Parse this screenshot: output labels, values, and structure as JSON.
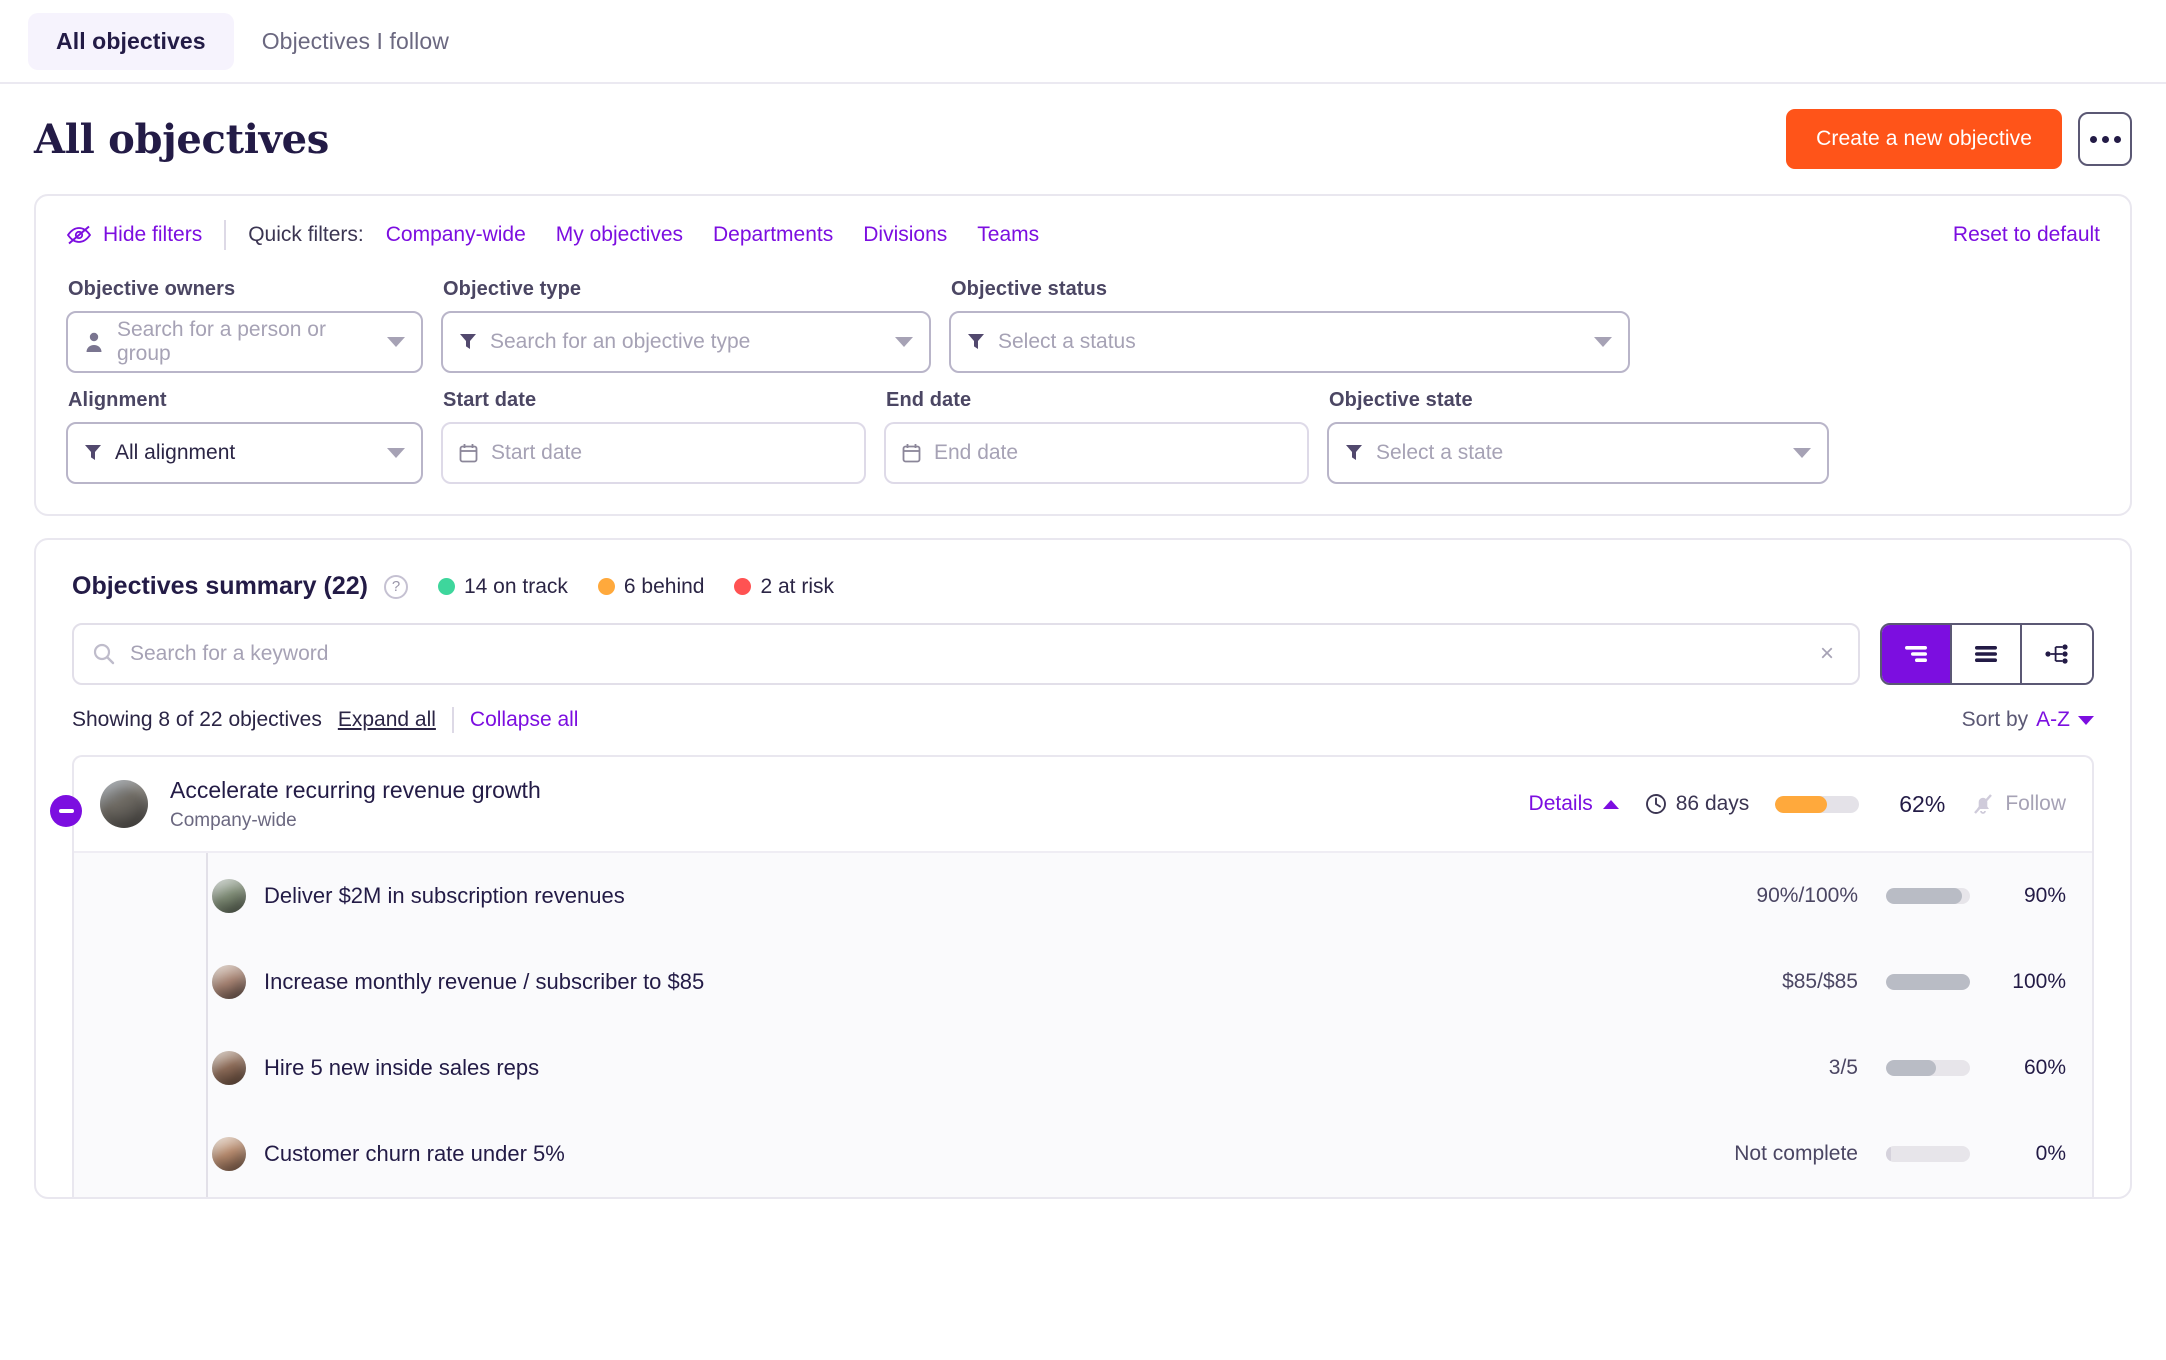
{
  "tabs": [
    {
      "label": "All objectives",
      "active": true
    },
    {
      "label": "Objectives I follow",
      "active": false
    }
  ],
  "header": {
    "title": "All objectives",
    "create_button": "Create a new objective",
    "more_menu": "more-options"
  },
  "filters": {
    "hide_filters": "Hide filters",
    "quick_filters_label": "Quick filters:",
    "quick_filters": [
      "Company-wide",
      "My objectives",
      "Departments",
      "Divisions",
      "Teams"
    ],
    "reset": "Reset to default",
    "fields": [
      {
        "label": "Objective owners",
        "placeholder": "Search for a person or group",
        "value": "",
        "icon": "person-icon"
      },
      {
        "label": "Objective type",
        "placeholder": "Search for an objective type",
        "value": "",
        "icon": "filter-icon"
      },
      {
        "label": "Objective status",
        "placeholder": "Select a status",
        "value": "",
        "icon": "filter-icon"
      },
      {
        "label": "Alignment",
        "placeholder": "",
        "value": "All alignment",
        "icon": "filter-icon"
      },
      {
        "label": "Start date",
        "placeholder": "Start date",
        "value": "",
        "icon": "calendar-icon"
      },
      {
        "label": "End date",
        "placeholder": "End date",
        "value": "",
        "icon": "calendar-icon"
      },
      {
        "label": "Objective state",
        "placeholder": "Select a state",
        "value": "",
        "icon": "filter-icon"
      }
    ]
  },
  "summary": {
    "title": "Objectives summary (22)",
    "help": "?",
    "stats": [
      {
        "label": "14 on track",
        "color": "#3ed69c"
      },
      {
        "label": "6 behind",
        "color": "#ffa93c"
      },
      {
        "label": "2 at risk",
        "color": "#ff5252"
      }
    ],
    "search_placeholder": "Search for a keyword",
    "search_value": "",
    "clear_icon": "×",
    "views": [
      {
        "name": "nested-list-view",
        "active": true
      },
      {
        "name": "flat-list-view",
        "active": false
      },
      {
        "name": "tree-view",
        "active": false
      }
    ],
    "showing": "Showing 8 of 22 objectives",
    "expand_all": "Expand all",
    "collapse_all": "Collapse all",
    "sort_label": "Sort by",
    "sort_value": "A-Z"
  },
  "objective": {
    "title": "Accelerate recurring revenue growth",
    "subtitle": "Company-wide",
    "details_label": "Details",
    "days": "86 days",
    "progress": 62,
    "progress_label": "62%",
    "progress_color": "#ffa93c",
    "follow_label": "Follow",
    "key_results": [
      {
        "title": "Deliver $2M in subscription revenues",
        "value": "90%/100%",
        "progress": 90,
        "progress_label": "90%"
      },
      {
        "title": "Increase monthly revenue / subscriber to $85",
        "value": "$85/$85",
        "progress": 100,
        "progress_label": "100%"
      },
      {
        "title": "Hire 5 new inside sales reps",
        "value": "3/5",
        "progress": 60,
        "progress_label": "60%"
      },
      {
        "title": "Customer churn rate under 5%",
        "value": "Not complete",
        "progress": 0,
        "progress_label": "0%"
      }
    ]
  }
}
